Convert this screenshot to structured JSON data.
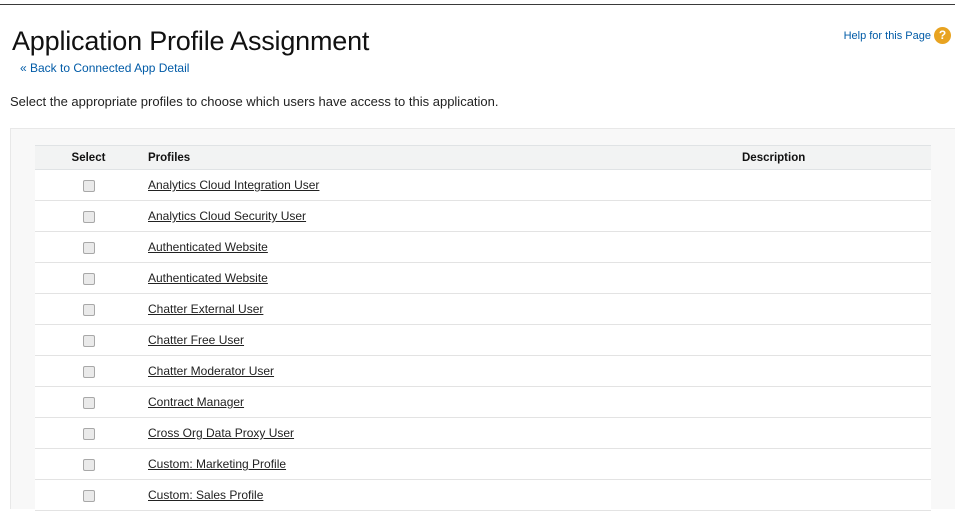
{
  "header": {
    "title": "Application Profile Assignment",
    "back_link": "« Back to Connected App Detail",
    "help_link": "Help for this Page",
    "help_icon": "?"
  },
  "instructions": "Select the appropriate profiles to choose which users have access to this application.",
  "table": {
    "columns": [
      "Select",
      "Profiles",
      "Description"
    ],
    "rows": [
      {
        "profile": "Analytics Cloud Integration User",
        "description": "",
        "checked": false
      },
      {
        "profile": "Analytics Cloud Security User",
        "description": "",
        "checked": false
      },
      {
        "profile": "Authenticated Website",
        "description": "",
        "checked": false
      },
      {
        "profile": "Authenticated Website",
        "description": "",
        "checked": false
      },
      {
        "profile": "Chatter External User",
        "description": "",
        "checked": false
      },
      {
        "profile": "Chatter Free User",
        "description": "",
        "checked": false
      },
      {
        "profile": "Chatter Moderator User",
        "description": "",
        "checked": false
      },
      {
        "profile": "Contract Manager",
        "description": "",
        "checked": false
      },
      {
        "profile": "Cross Org Data Proxy User",
        "description": "",
        "checked": false
      },
      {
        "profile": "Custom: Marketing Profile",
        "description": "",
        "checked": false
      },
      {
        "profile": "Custom: Sales Profile",
        "description": "",
        "checked": false
      }
    ]
  },
  "colors": {
    "link": "#015ba7",
    "help_icon": "#e8a321",
    "header_bg": "#f2f3f3"
  },
  "icons": {
    "help": "help-icon"
  }
}
